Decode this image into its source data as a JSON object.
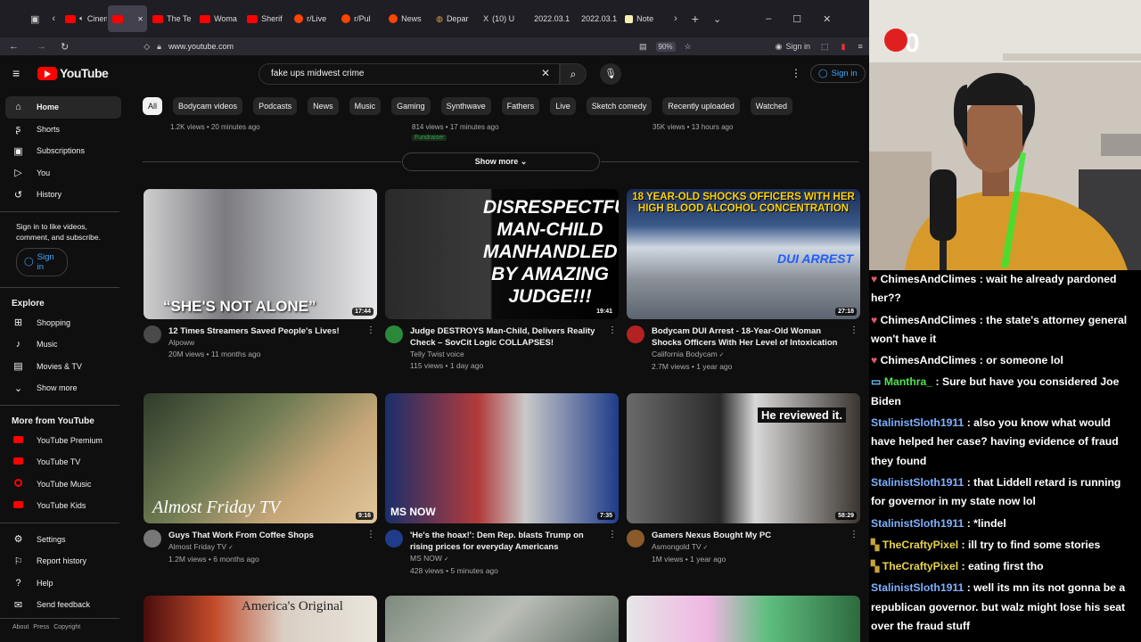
{
  "browser": {
    "tabs": [
      {
        "label": "Cinem",
        "fav": "yt",
        "audio": true
      },
      {
        "label": "",
        "fav": "yt",
        "active": true
      },
      {
        "label": "The Te",
        "fav": "yt"
      },
      {
        "label": "Woma",
        "fav": "yt"
      },
      {
        "label": "Sherif",
        "fav": "yt"
      },
      {
        "label": "r/Live",
        "fav": "rd"
      },
      {
        "label": "r/Pul",
        "fav": "rd"
      },
      {
        "label": "News",
        "fav": "rd"
      },
      {
        "label": "Depar",
        "fav": "gen"
      },
      {
        "label": "(10) U",
        "fav": "x"
      },
      {
        "label": "2022.03.1",
        "fav": "none"
      },
      {
        "label": "2022.03.1",
        "fav": "none"
      },
      {
        "label": "Note",
        "fav": "note"
      }
    ],
    "url": "www.youtube.com",
    "zoom": "90%",
    "signin_label": "Sign in"
  },
  "youtube": {
    "logo_text": "YouTube",
    "search_value": "fake ups midwest crime",
    "signin_label": "Sign in",
    "sidebar": {
      "main": [
        {
          "label": "Home",
          "icon": "home-icon",
          "glyph": "⌂",
          "active": true
        },
        {
          "label": "Shorts",
          "icon": "shorts-icon",
          "glyph": "ʂ"
        },
        {
          "label": "Subscriptions",
          "icon": "subscriptions-icon",
          "glyph": "▣"
        },
        {
          "label": "You",
          "icon": "you-icon",
          "glyph": "▷"
        },
        {
          "label": "History",
          "icon": "history-icon",
          "glyph": "↺"
        }
      ],
      "signin_prompt": "Sign in to like videos, comment, and subscribe.",
      "signin_label": "Sign in",
      "explore_title": "Explore",
      "explore": [
        {
          "label": "Shopping",
          "icon": "shopping-icon",
          "glyph": "⊞"
        },
        {
          "label": "Music",
          "icon": "music-icon",
          "glyph": "♪"
        },
        {
          "label": "Movies & TV",
          "icon": "movies-icon",
          "glyph": "▤"
        },
        {
          "label": "Show more",
          "icon": "chevron-down-icon",
          "glyph": "⌄"
        }
      ],
      "more_title": "More from YouTube",
      "more": [
        {
          "label": "YouTube Premium",
          "icon": "youtube-premium-icon"
        },
        {
          "label": "YouTube TV",
          "icon": "youtube-tv-icon"
        },
        {
          "label": "YouTube Music",
          "icon": "youtube-music-icon"
        },
        {
          "label": "YouTube Kids",
          "icon": "youtube-kids-icon"
        }
      ],
      "bottom": [
        {
          "label": "Settings",
          "icon": "settings-icon",
          "glyph": "⚙"
        },
        {
          "label": "Report history",
          "icon": "flag-icon",
          "glyph": "⚐"
        },
        {
          "label": "Help",
          "icon": "help-icon",
          "glyph": "?"
        },
        {
          "label": "Send feedback",
          "icon": "feedback-icon",
          "glyph": "✉"
        }
      ],
      "footer": [
        "About",
        "Press",
        "Copyright"
      ]
    },
    "chips": [
      "All",
      "Bodycam videos",
      "Podcasts",
      "News",
      "Music",
      "Gaming",
      "Synthwave",
      "Fathers",
      "Live",
      "Sketch comedy",
      "Recently uploaded",
      "Watched"
    ],
    "top_row": [
      {
        "stats": "1.2K views • 20 minutes ago"
      },
      {
        "stats": "814 views • 17 minutes ago",
        "badge": "Fundraiser"
      },
      {
        "stats": "35K views • 13 hours ago"
      }
    ],
    "show_more": "Show more",
    "videos": [
      {
        "title": "12 Times Streamers Saved People's Lives!",
        "channel": "Alpoww",
        "stats": "20M views • 11 months ago",
        "duration": "17:44",
        "thumb_text": "“SHE'S NOT ALONE”",
        "verified": false
      },
      {
        "title": "Judge DESTROYS Man-Child, Delivers Reality Check – SovCit Logic COLLAPSES!",
        "channel": "Telly Twist voice",
        "stats": "115 views • 1 day ago",
        "duration": "19:41",
        "thumb_text": "DISRESPECTFUL MAN-CHILD MANHANDLED BY AMAZING JUDGE!!!",
        "verified": false
      },
      {
        "title": "Bodycam DUI Arrest - 18-Year-Old Woman Shocks Officers With Her Level of Intoxication",
        "channel": "California Bodycam",
        "stats": "2.7M views • 1 year ago",
        "duration": "27:18",
        "thumb_text": "18 YEAR-OLD SHOCKS OFFICERS WITH HER HIGH BLOOD ALCOHOL CONCENTRATION",
        "thumb_text2": "DUI ARREST",
        "verified": true
      },
      {
        "title": "Guys That Work From Coffee Shops",
        "channel": "Almost Friday TV",
        "stats": "1.2M views • 6 months ago",
        "duration": "9:16",
        "thumb_text": "Almost Friday TV",
        "verified": true
      },
      {
        "title": "'He's the hoax!': Dem Rep. blasts Trump on rising prices for everyday Americans",
        "channel": "MS NOW",
        "stats": "428 views • 5 minutes ago",
        "duration": "7:35",
        "thumb_text": "MS NOW",
        "verified": true
      },
      {
        "title": "Gamers Nexus Bought My PC",
        "channel": "Asmongold TV",
        "stats": "1M views • 1 year ago",
        "duration": "58:29",
        "thumb_text": "He reviewed it.",
        "verified": true
      }
    ],
    "bottom_thumb_text": "America's Original"
  },
  "stream": {
    "counter": "0",
    "chat": [
      {
        "user": "ChimesAndClimes",
        "text": "wait he already pardoned her??",
        "color": "#ffffff",
        "badge": "heart"
      },
      {
        "user": "ChimesAndClimes",
        "text": "the state's attorney general won't have it",
        "color": "#ffffff",
        "badge": "heart"
      },
      {
        "user": "ChimesAndClimes",
        "text": "or someone lol",
        "color": "#ffffff",
        "badge": "heart"
      },
      {
        "user": "Manthra_",
        "text": "Sure but have you considered Joe Biden",
        "color": "#4ee44e",
        "badge": "monitor"
      },
      {
        "user": "StalinistSloth1911",
        "text": "also you know what would have helped her case? having evidence of fraud they found",
        "color": "#7eb0ff",
        "badge": "none"
      },
      {
        "user": "StalinistSloth1911",
        "text": "that Liddell retard is running for governor in my state now lol",
        "color": "#7eb0ff",
        "badge": "none"
      },
      {
        "user": "StalinistSloth1911",
        "text": "*lindel",
        "color": "#7eb0ff",
        "badge": "none"
      },
      {
        "user": "TheCraftyPixel",
        "text": "ill try to find some stories",
        "color": "#e9d34a",
        "badge": "pixel"
      },
      {
        "user": "TheCraftyPixel",
        "text": "eating first tho",
        "color": "#e9d34a",
        "badge": "pixel"
      },
      {
        "user": "StalinistSloth1911",
        "text": "well its mn its not gonna be a republican governor. but walz might lose his seat over the fraud stuff",
        "color": "#7eb0ff",
        "badge": "none"
      }
    ]
  }
}
